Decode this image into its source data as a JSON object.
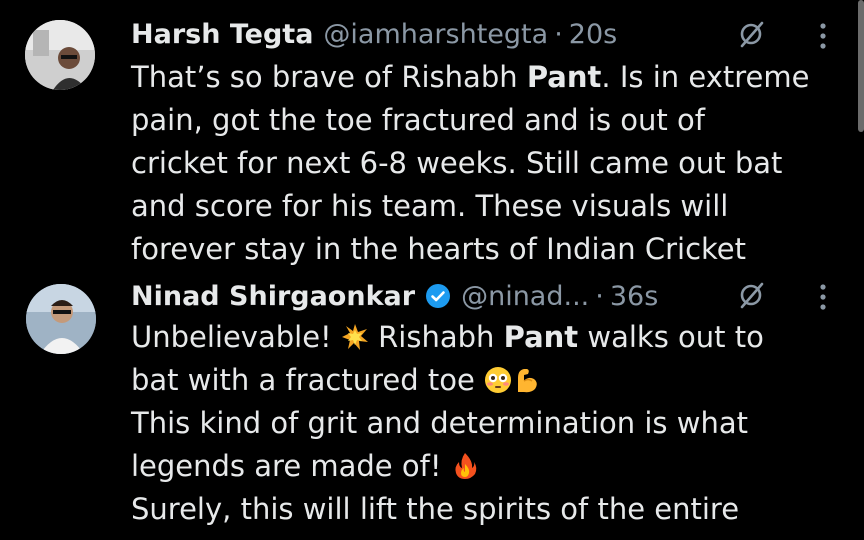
{
  "tweets": [
    {
      "name": "Harsh Tegta",
      "handle": "@iamharshtegta",
      "dot": "·",
      "time": "20s",
      "lines": [
        {
          "pre": "That’s so brave of Rishabh ",
          "bold": "Pant",
          "post": ". Is in extreme"
        },
        {
          "text": "pain, got the toe fractured and is out of"
        },
        {
          "text": "cricket for next 6-8 weeks. Still came out bat"
        },
        {
          "text": "and score for his team. These visuals will"
        },
        {
          "text": "forever stay in the hearts of Indian Cricket"
        }
      ]
    },
    {
      "name": "Ninad Shirgaonkar",
      "handle": "@ninad...",
      "dot": "·",
      "time": "36s",
      "lines": [
        {
          "pre": "Unbelievable! ",
          "emoji": "collision-emoji",
          "mid": " Rishabh ",
          "bold": "Pant",
          "post": " walks out to"
        },
        {
          "text": "bat with a fractured toe "
        },
        {
          "text": "This kind of grit and determination is what"
        },
        {
          "text": "legends are made of! "
        },
        {
          "text": "Surely, this will lift the spirits of the entire"
        }
      ]
    }
  ],
  "colors": {
    "background": "#000000",
    "text": "#e7e9ea",
    "muted": "#8b98a5",
    "verified": "#1d9bf0"
  },
  "icons": [
    "grok-icon",
    "more-options-icon",
    "verified-badge-icon",
    "collision-emoji",
    "flushed-face-emoji",
    "flexed-biceps-emoji",
    "fire-emoji"
  ]
}
